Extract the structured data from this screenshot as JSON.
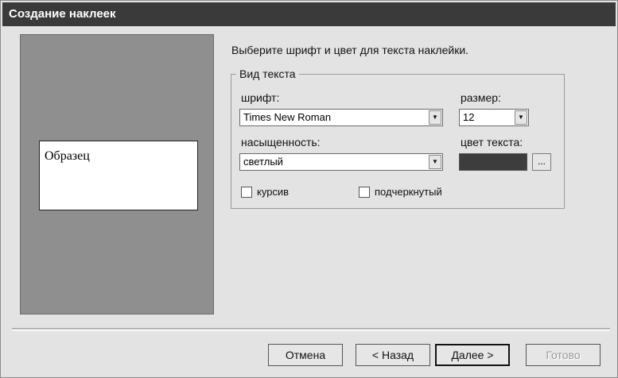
{
  "window": {
    "title": "Создание наклеек"
  },
  "preview": {
    "sample_text": "Образец"
  },
  "instructions": "Выберите шрифт и цвет для текста наклейки.",
  "group": {
    "legend": "Вид текста"
  },
  "font": {
    "label": "шрифт:",
    "value": "Times New Roman"
  },
  "size": {
    "label": "размер:",
    "value": "12"
  },
  "weight": {
    "label": "насыщенность:",
    "value": "светлый"
  },
  "text_color": {
    "label": "цвет текста:",
    "value": "#3d3d3d",
    "button": "..."
  },
  "italic": {
    "label": "курсив",
    "checked": false
  },
  "underline": {
    "label": "подчеркнутый",
    "checked": false
  },
  "buttons": {
    "cancel": "Отмена",
    "back": "< Назад",
    "next": "Далее >",
    "finish": "Готово"
  },
  "icons": {
    "dropdown": "chevron-down-icon"
  }
}
